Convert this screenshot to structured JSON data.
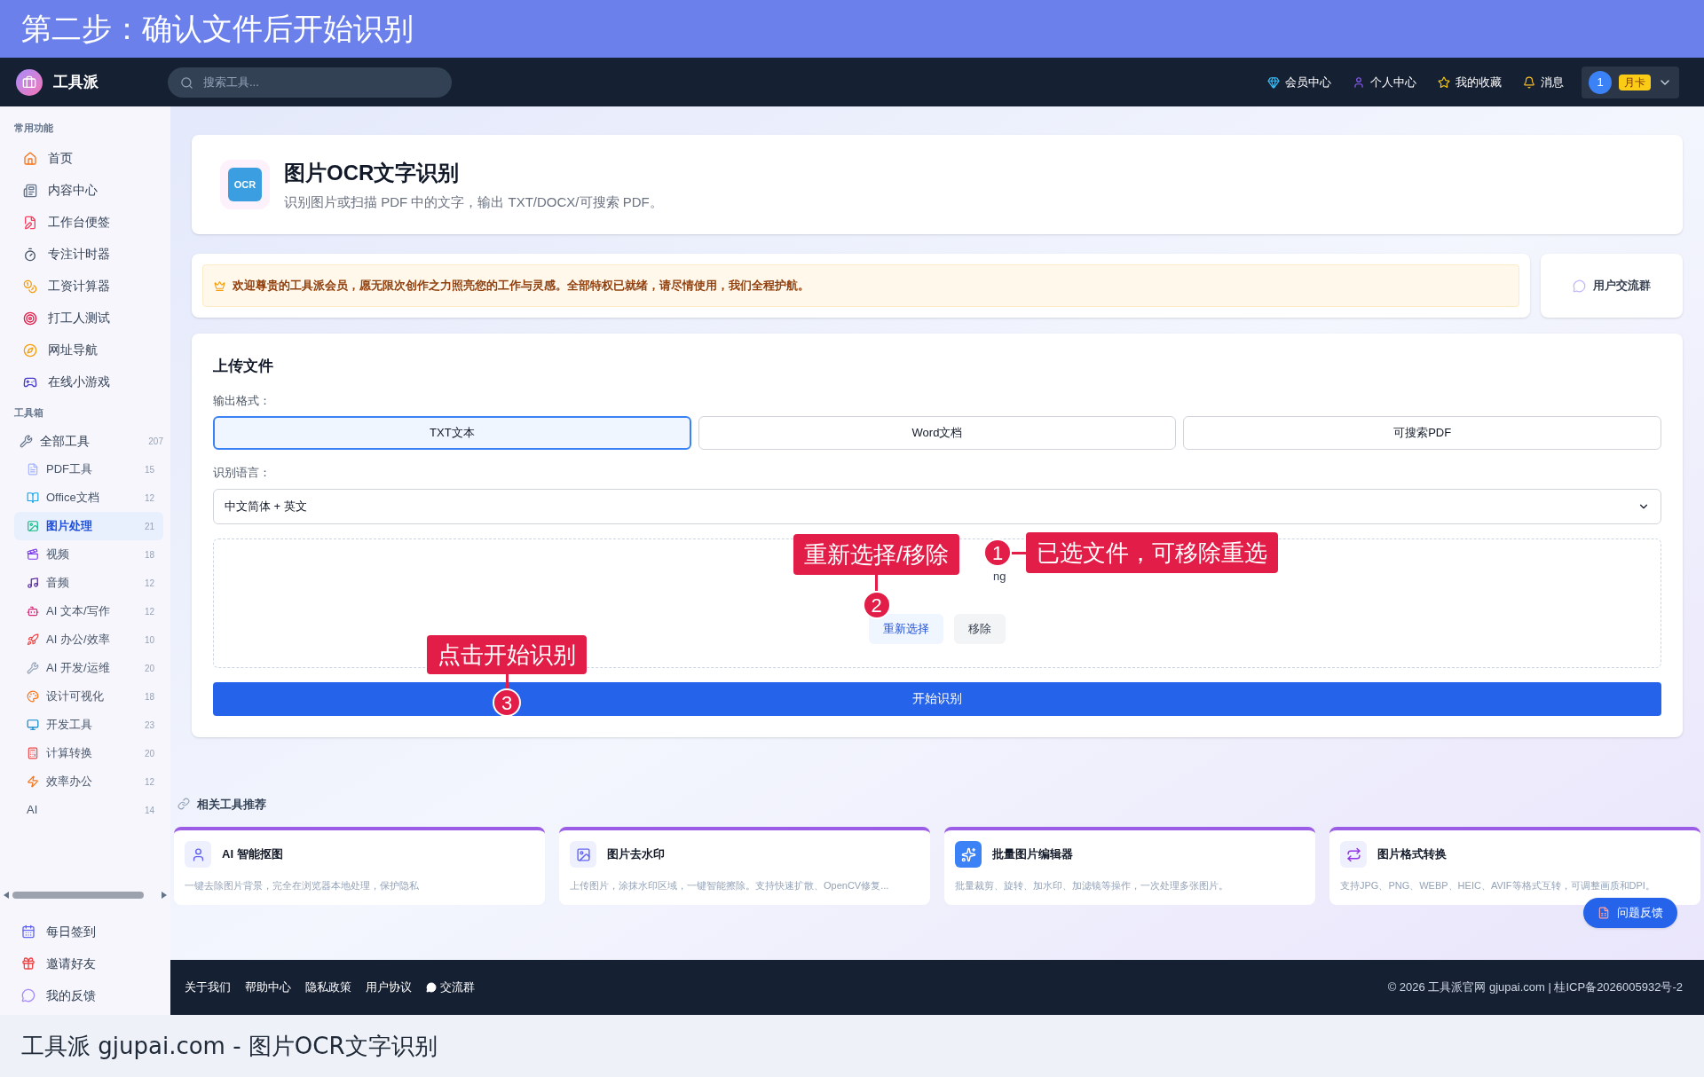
{
  "banner": {
    "title": "第二步：确认文件后开始识别"
  },
  "navbar": {
    "brand": "工具派",
    "search": {
      "placeholder": "搜索工具..."
    },
    "links": [
      "会员中心",
      "个人中心",
      "我的收藏",
      "消息"
    ],
    "user": {
      "avatar": "1",
      "badge": "月卡"
    }
  },
  "sidebar": {
    "sections": [
      {
        "title": "常用功能",
        "items": [
          {
            "label": "首页",
            "selected": false
          },
          {
            "label": "内容中心",
            "selected": false
          },
          {
            "label": "工作台便签",
            "selected": false
          },
          {
            "label": "专注计时器",
            "selected": false
          },
          {
            "label": "工资计算器",
            "selected": false
          },
          {
            "label": "打工人测试",
            "selected": false
          },
          {
            "label": "网址导航",
            "selected": false
          },
          {
            "label": "在线小游戏",
            "selected": false
          }
        ]
      },
      {
        "title": "工具箱",
        "items": [
          {
            "label": "全部工具",
            "count": "207",
            "selected": false,
            "children": [
              {
                "label": "PDF工具",
                "count": "15",
                "selected": false
              },
              {
                "label": "Office文档",
                "count": "12",
                "selected": false
              },
              {
                "label": "图片处理",
                "count": "21",
                "selected": true
              },
              {
                "label": "视频",
                "count": "18",
                "selected": false
              },
              {
                "label": "音频",
                "count": "12",
                "selected": false
              },
              {
                "label": "AI 文本/写作",
                "count": "12",
                "selected": false
              },
              {
                "label": "AI 办公/效率",
                "count": "10",
                "selected": false
              },
              {
                "label": "AI 开发/运维",
                "count": "20",
                "selected": false
              },
              {
                "label": "设计可视化",
                "count": "18",
                "selected": false
              },
              {
                "label": "开发工具",
                "count": "23",
                "selected": false
              },
              {
                "label": "计算转换",
                "count": "20",
                "selected": false
              },
              {
                "label": "效率办公",
                "count": "12",
                "selected": false
              },
              {
                "label": "AI",
                "count": "14",
                "selected": false
              }
            ]
          }
        ]
      }
    ],
    "bottom_items": [
      "每日签到",
      "邀请好友",
      "我的反馈"
    ]
  },
  "header": {
    "logo": "OCR",
    "title": "图片OCR文字识别",
    "subtitle": "识别图片或扫描 PDF 中的文字，输出 TXT/DOCX/可搜索 PDF。"
  },
  "notice": {
    "text": "欢迎尊贵的工具派会员，愿无限次创作之力照亮您的工作与灵感。全部特权已就绪，请尽情使用，我们全程护航。",
    "group_button": "用户交流群"
  },
  "upload": {
    "title": "上传文件",
    "format_label": "输出格式：",
    "formats": [
      {
        "label": "TXT文本",
        "selected": true
      },
      {
        "label": "Word文档",
        "selected": false
      },
      {
        "label": "可搜索PDF",
        "selected": false
      }
    ],
    "language_label": "识别语言：",
    "language": "中文简体 + 英文",
    "file_name": "ng",
    "buttons": [
      "重新选择",
      "移除"
    ],
    "start": "开始识别"
  },
  "annotations": [
    {
      "number": "2",
      "text": "重新选择/移除"
    },
    {
      "number": "1",
      "text": "已选文件，可移除重选"
    },
    {
      "number": "3",
      "text": "点击开始识别"
    }
  ],
  "related": {
    "title": "相关工具推荐",
    "cards": [
      {
        "title": "AI 智能抠图",
        "description": "一键去除图片背景，完全在浏览器本地处理，保护隐私"
      },
      {
        "title": "图片去水印",
        "description": "上传图片，涂抹水印区域，一键智能擦除。支持快速扩散、OpenCV修复..."
      },
      {
        "title": "批量图片编辑器",
        "description": "批量裁剪、旋转、加水印、加滤镜等操作，一次处理多张图片。"
      },
      {
        "title": "图片格式转换",
        "description": "支持JPG、PNG、WEBP、HEIC、AVIF等格式互转，可调整画质和DPI。"
      }
    ]
  },
  "feedback_button": "问题反馈",
  "footer": {
    "links": [
      "关于我们",
      "帮助中心",
      "隐私政策",
      "用户协议",
      "交流群"
    ],
    "copyright": "© 2026 工具派官网 gjupai.com | 桂ICP备2026005932号-2"
  },
  "caption": "工具派 gjupai.com - 图片OCR文字识别"
}
